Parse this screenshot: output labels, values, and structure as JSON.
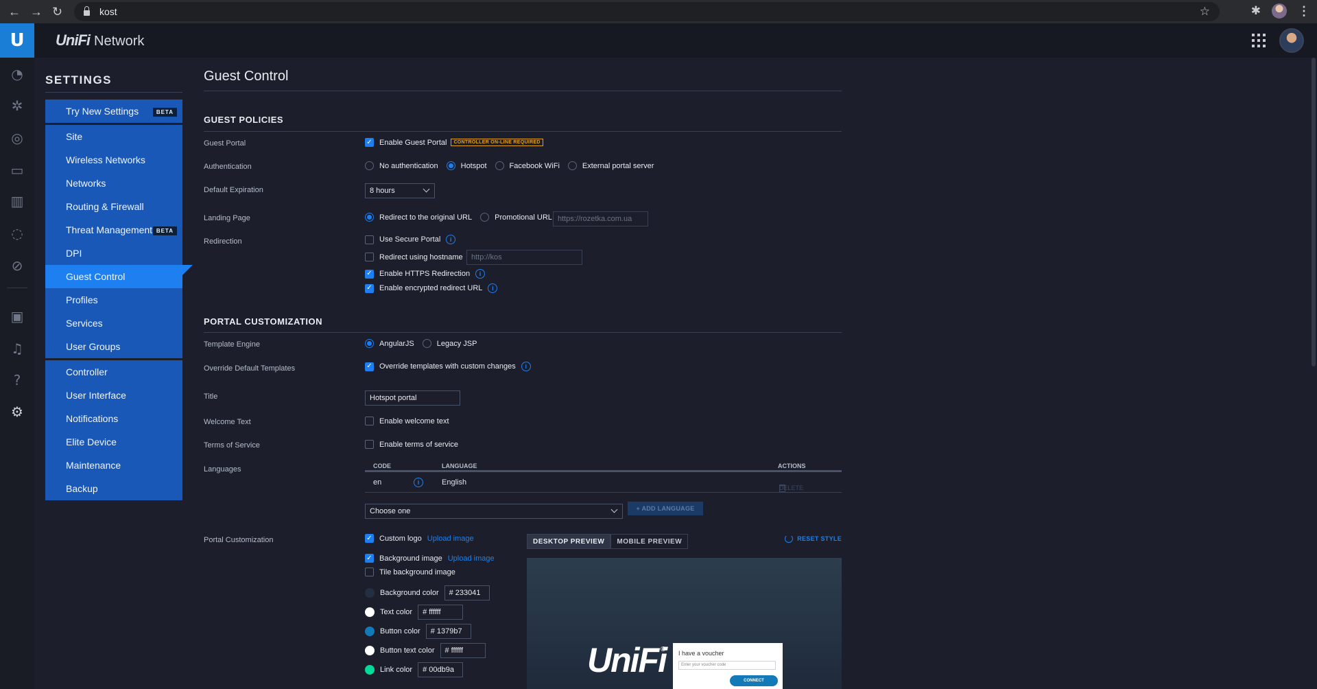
{
  "browser": {
    "url": "kost",
    "back_icon": "back-arrow-icon",
    "forward_icon": "forward-arrow-icon",
    "reload_icon": "reload-icon"
  },
  "app": {
    "brand_logo": "UniFi",
    "brand_name": "Network",
    "rail_logo": "U"
  },
  "settings": {
    "title": "SETTINGS",
    "groups": [
      [
        {
          "label": "Try New Settings",
          "badge": "BETA",
          "active": false
        }
      ],
      [
        {
          "label": "Site",
          "active": false
        },
        {
          "label": "Wireless Networks",
          "active": false
        },
        {
          "label": "Networks",
          "active": false
        },
        {
          "label": "Routing & Firewall",
          "active": false
        },
        {
          "label": "Threat Management",
          "badge": "BETA",
          "active": false
        },
        {
          "label": "DPI",
          "active": false
        },
        {
          "label": "Guest Control",
          "active": true
        },
        {
          "label": "Profiles",
          "active": false
        },
        {
          "label": "Services",
          "active": false
        },
        {
          "label": "User Groups",
          "active": false
        }
      ],
      [
        {
          "label": "Controller",
          "active": false
        },
        {
          "label": "User Interface",
          "active": false
        },
        {
          "label": "Notifications",
          "active": false
        },
        {
          "label": "Elite Device",
          "active": false
        },
        {
          "label": "Maintenance",
          "active": false
        },
        {
          "label": "Backup",
          "active": false
        }
      ]
    ]
  },
  "page": {
    "title": "Guest Control",
    "guest_policies": {
      "title": "GUEST POLICIES",
      "guest_portal_label": "Guest Portal",
      "enable_guest_portal": "Enable Guest Portal",
      "controller_badge": "CONTROLLER ON-LINE REQUIRED",
      "authentication_label": "Authentication",
      "auth_options": [
        "No authentication",
        "Hotspot",
        "Facebook WiFi",
        "External portal server"
      ],
      "auth_selected": "Hotspot",
      "expiration_label": "Default Expiration",
      "expiration_value": "8 hours",
      "landing_label": "Landing Page",
      "landing_original": "Redirect to the original URL",
      "landing_promo": "Promotional URL",
      "promo_placeholder": "https://rozetka.com.ua",
      "redirection_label": "Redirection",
      "secure_portal": "Use Secure Portal",
      "redirect_hostname": "Redirect using hostname",
      "hostname_value": "http://kos",
      "https_redirect": "Enable HTTPS Redirection",
      "encrypted_redirect": "Enable encrypted redirect URL"
    },
    "portal": {
      "title": "PORTAL CUSTOMIZATION",
      "template_label": "Template Engine",
      "template_angular": "AngularJS",
      "template_jsp": "Legacy JSP",
      "override_label": "Override Default Templates",
      "override_text": "Override templates with custom changes",
      "title_label": "Title",
      "title_value": "Hotspot portal",
      "welcome_label": "Welcome Text",
      "welcome_text": "Enable welcome text",
      "tos_label": "Terms of Service",
      "tos_text": "Enable terms of service",
      "languages_label": "Languages",
      "lang_columns": {
        "code": "CODE",
        "language": "LANGUAGE",
        "actions": "ACTIONS"
      },
      "lang_rows": [
        {
          "code": "en",
          "language": "English",
          "action": "DELETE"
        }
      ],
      "choose_one": "Choose one",
      "add_language": "+ ADD LANGUAGE",
      "custom_label": "Portal Customization",
      "custom_logo": "Custom logo",
      "upload_1": "Upload image",
      "bg_image": "Background image",
      "upload_2": "Upload image",
      "tile_bg": "Tile background image",
      "colors": [
        {
          "label": "Background color",
          "hex": "# 233041",
          "color": "#233041"
        },
        {
          "label": "Text color",
          "hex": "# ffffff",
          "color": "#ffffff"
        },
        {
          "label": "Button color",
          "hex": "# 1379b7",
          "color": "#1379b7"
        },
        {
          "label": "Button text color",
          "hex": "# ffffff",
          "color": "#ffffff"
        },
        {
          "label": "Link color",
          "hex": "# 00db9a",
          "color": "#00db9a"
        }
      ],
      "desktop_preview": "DESKTOP PREVIEW",
      "mobile_preview": "MOBILE PREVIEW",
      "reset_style": "RESET STYLE",
      "preview": {
        "logo": "UniFi",
        "reg": "®",
        "voucher_title": "I have a voucher",
        "voucher_placeholder": "Enter your voucher code",
        "connect": "CONNECT"
      }
    }
  }
}
